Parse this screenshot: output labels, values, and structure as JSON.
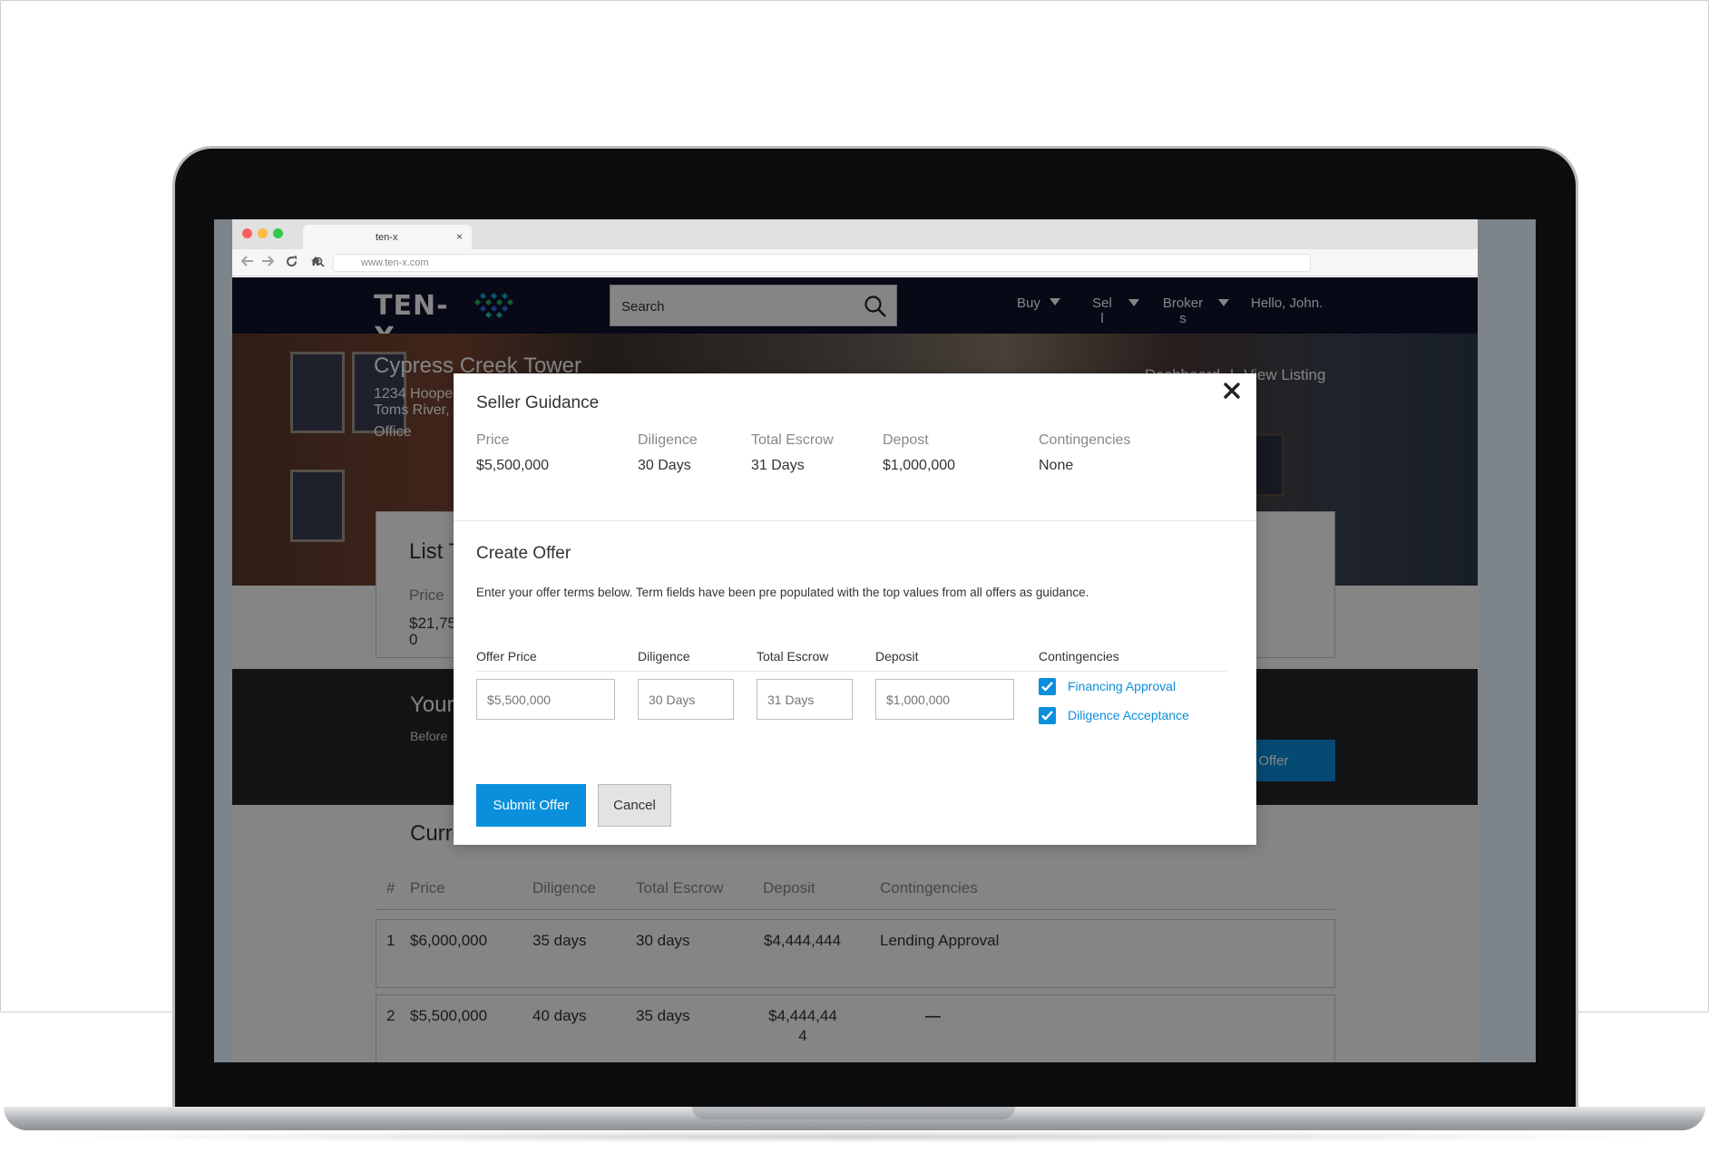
{
  "browser": {
    "tab_title": "ten-x",
    "tab_close": "×",
    "url": "www.ten-x.com"
  },
  "site": {
    "logo_text": "TEN-X",
    "search_label": "Search",
    "nav": [
      "Buy",
      "Sel\nl",
      "Broker\ns"
    ],
    "greeting": "Hello, John."
  },
  "hero": {
    "title": "Cypress Creek Tower",
    "address_line1": "1234 Hoope",
    "address_line2": "Toms River,",
    "type": "Office",
    "link_dashboard": "Dashboard",
    "link_separator": "|",
    "link_view_listing": "View Listing"
  },
  "list_card": {
    "title": "List T",
    "price_label": "Price",
    "price_value": "$21,750"
  },
  "band": {
    "title": "Your",
    "subtitle": "Before",
    "button": "eate Offer"
  },
  "current_offers": {
    "title": "Current Offers",
    "headers": [
      "#",
      "Price",
      "Diligence",
      "Total Escrow",
      "Deposit",
      "Contingencies"
    ],
    "rows": [
      {
        "num": "1",
        "price": "$6,000,000",
        "diligence": "35 days",
        "escrow": "30 days",
        "deposit": "$4,444,444",
        "contingencies": "Lending Approval"
      },
      {
        "num": "2",
        "price": "$5,500,000",
        "diligence": "40 days",
        "escrow": "35 days",
        "deposit": "$4,444,444",
        "contingencies": "—"
      }
    ]
  },
  "modal": {
    "seller_guidance_title": "Seller Guidance",
    "guidance": [
      {
        "label": "Price",
        "value": "$5,500,000"
      },
      {
        "label": "Diligence",
        "value": "30 Days"
      },
      {
        "label": "Total Escrow",
        "value": "31 Days"
      },
      {
        "label": "Depost",
        "value": "$1,000,000"
      },
      {
        "label": "Contingencies",
        "value": "None"
      }
    ],
    "create_offer_title": "Create Offer",
    "description": "Enter your offer terms below. Term fields have been pre populated with the top values from all offers as guidance.",
    "fields": {
      "offer_price": {
        "label": "Offer Price",
        "placeholder": "$5,500,000"
      },
      "diligence": {
        "label": "Diligence",
        "placeholder": "30 Days"
      },
      "total_escrow": {
        "label": "Total Escrow",
        "placeholder": "31 Days"
      },
      "deposit": {
        "label": "Deposit",
        "placeholder": "$1,000,000"
      },
      "contingencies": {
        "label": "Contingencies"
      }
    },
    "checkboxes": [
      {
        "label": "Financing Approval",
        "checked": true
      },
      {
        "label": "Diligence Acceptance",
        "checked": true
      }
    ],
    "submit_label": "Submit Offer",
    "cancel_label": "Cancel"
  },
  "colors": {
    "accent": "#0a8fdc",
    "nav_bg": "#10122b",
    "overlay": "rgba(0,0,0,0.48)"
  }
}
